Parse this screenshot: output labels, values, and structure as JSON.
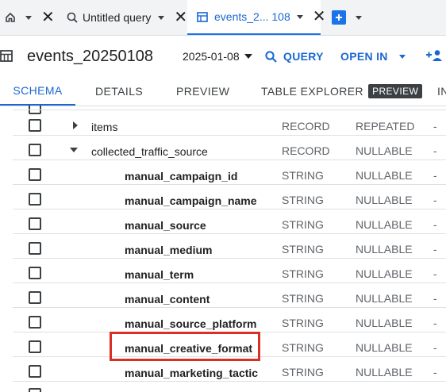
{
  "tabs": [
    {
      "icon": "home-icon",
      "label": ""
    },
    {
      "icon": "query-icon",
      "label": "Untitled query"
    },
    {
      "icon": "table-icon",
      "label": "events_2... 108"
    }
  ],
  "header": {
    "table_name": "events_20250108",
    "date": "2025-01-08",
    "query_label": "QUERY",
    "open_in_label": "OPEN IN"
  },
  "section_tabs": {
    "schema": "SCHEMA",
    "details": "DETAILS",
    "preview": "PREVIEW",
    "table_explorer": "TABLE EXPLORER",
    "table_explorer_badge": "PREVIEW",
    "insights": "IN"
  },
  "schema_rows": [
    {
      "field": "items",
      "type": "RECORD",
      "mode": "REPEATED",
      "desc": "-"
    },
    {
      "field": "collected_traffic_source",
      "type": "RECORD",
      "mode": "NULLABLE",
      "desc": "-"
    },
    {
      "field": "manual_campaign_id",
      "type": "STRING",
      "mode": "NULLABLE",
      "desc": "-"
    },
    {
      "field": "manual_campaign_name",
      "type": "STRING",
      "mode": "NULLABLE",
      "desc": "-"
    },
    {
      "field": "manual_source",
      "type": "STRING",
      "mode": "NULLABLE",
      "desc": "-"
    },
    {
      "field": "manual_medium",
      "type": "STRING",
      "mode": "NULLABLE",
      "desc": "-"
    },
    {
      "field": "manual_term",
      "type": "STRING",
      "mode": "NULLABLE",
      "desc": "-"
    },
    {
      "field": "manual_content",
      "type": "STRING",
      "mode": "NULLABLE",
      "desc": "-"
    },
    {
      "field": "manual_source_platform",
      "type": "STRING",
      "mode": "NULLABLE",
      "desc": "-"
    },
    {
      "field": "manual_creative_format",
      "type": "STRING",
      "mode": "NULLABLE",
      "desc": "-"
    },
    {
      "field": "manual_marketing_tactic",
      "type": "STRING",
      "mode": "NULLABLE",
      "desc": "-"
    }
  ],
  "colors": {
    "accent": "#1967d2",
    "highlight": "#d93025"
  }
}
